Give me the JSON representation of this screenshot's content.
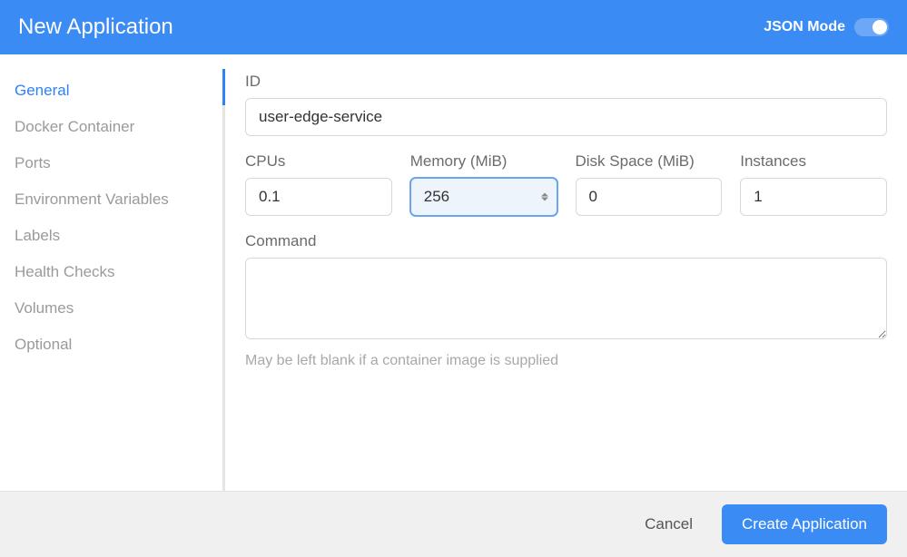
{
  "header": {
    "title": "New Application",
    "json_mode_label": "JSON Mode"
  },
  "sidebar": {
    "items": [
      {
        "label": "General",
        "active": true
      },
      {
        "label": "Docker Container",
        "active": false
      },
      {
        "label": "Ports",
        "active": false
      },
      {
        "label": "Environment Variables",
        "active": false
      },
      {
        "label": "Labels",
        "active": false
      },
      {
        "label": "Health Checks",
        "active": false
      },
      {
        "label": "Volumes",
        "active": false
      },
      {
        "label": "Optional",
        "active": false
      }
    ]
  },
  "form": {
    "id": {
      "label": "ID",
      "value": "user-edge-service"
    },
    "cpus": {
      "label": "CPUs",
      "value": "0.1"
    },
    "memory": {
      "label": "Memory (MiB)",
      "value": "256"
    },
    "disk": {
      "label": "Disk Space (MiB)",
      "value": "0"
    },
    "instances": {
      "label": "Instances",
      "value": "1"
    },
    "command": {
      "label": "Command",
      "value": "",
      "helper": "May be left blank if a container image is supplied"
    }
  },
  "footer": {
    "cancel": "Cancel",
    "create": "Create Application"
  },
  "colors": {
    "primary": "#3b8bf4",
    "text_muted": "#9a9a9a",
    "text_label": "#6b6b6b"
  }
}
